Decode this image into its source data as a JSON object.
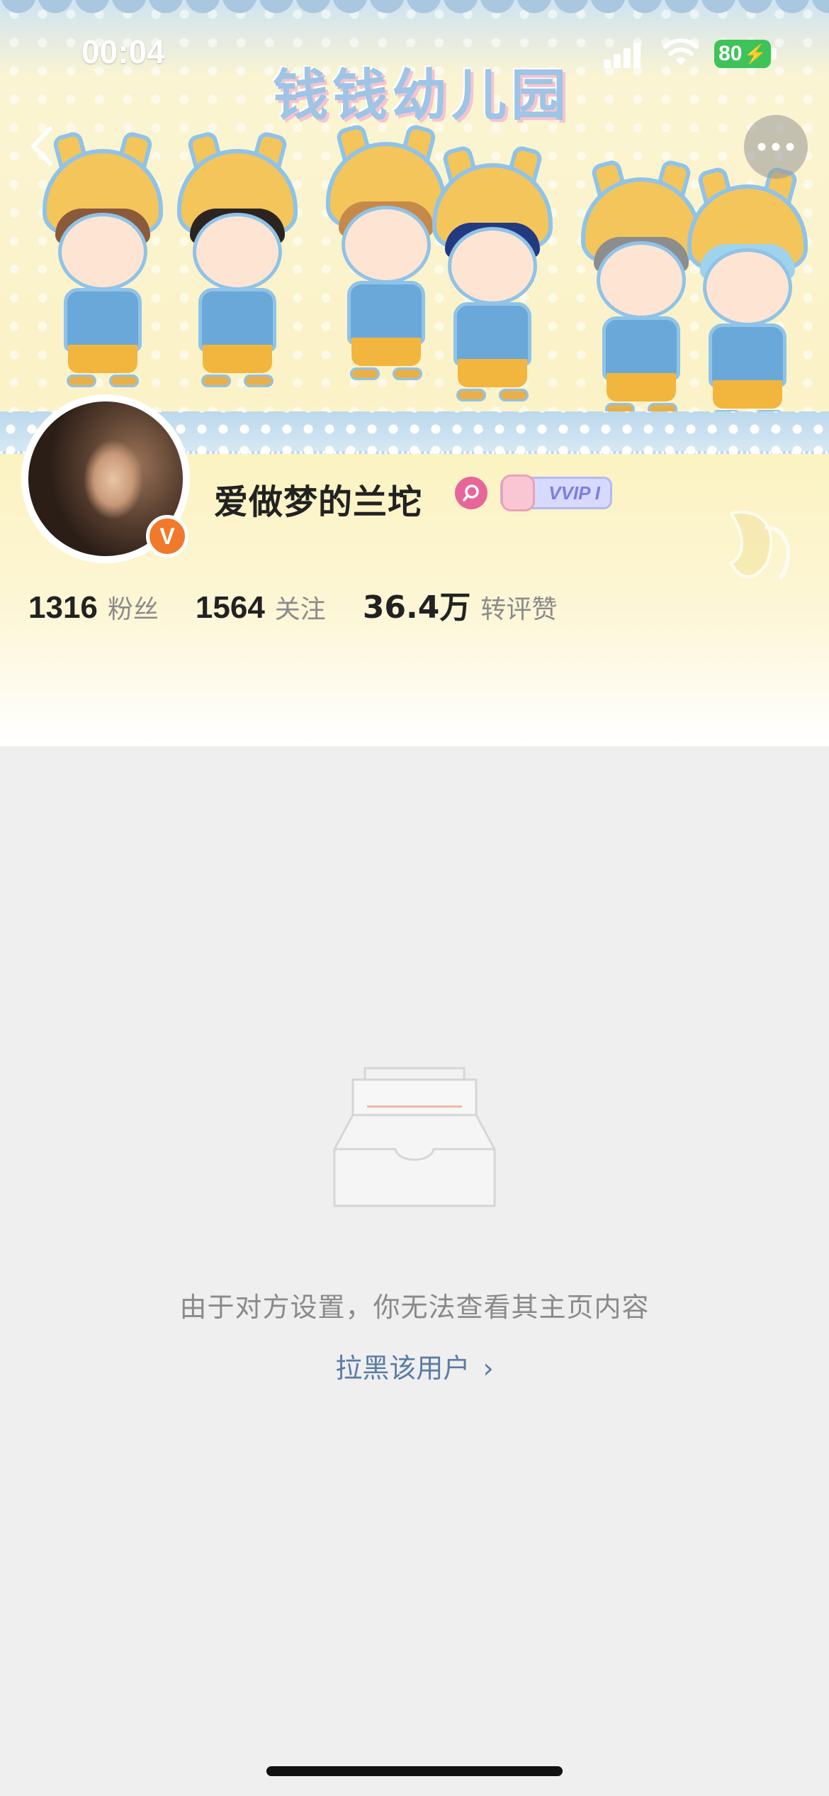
{
  "status_bar": {
    "time": "00:04",
    "battery": "80"
  },
  "cover": {
    "banner_text": "钱钱幼儿园"
  },
  "profile": {
    "username": "爱做梦的兰坨",
    "verified_mark": "V",
    "vip_badge": "VVIP I",
    "stats": [
      {
        "value": "1316",
        "label": "粉丝"
      },
      {
        "value": "1564",
        "label": "关注"
      },
      {
        "value": "36.4万",
        "label": "转评赞"
      }
    ]
  },
  "empty_state": {
    "message": "由于对方设置，你无法查看其主页内容",
    "block_link": "拉黑该用户"
  },
  "colors": {
    "accent_link": "#5b7ca6",
    "verified_orange": "#f07a2b",
    "battery_green": "#3ec35a"
  }
}
